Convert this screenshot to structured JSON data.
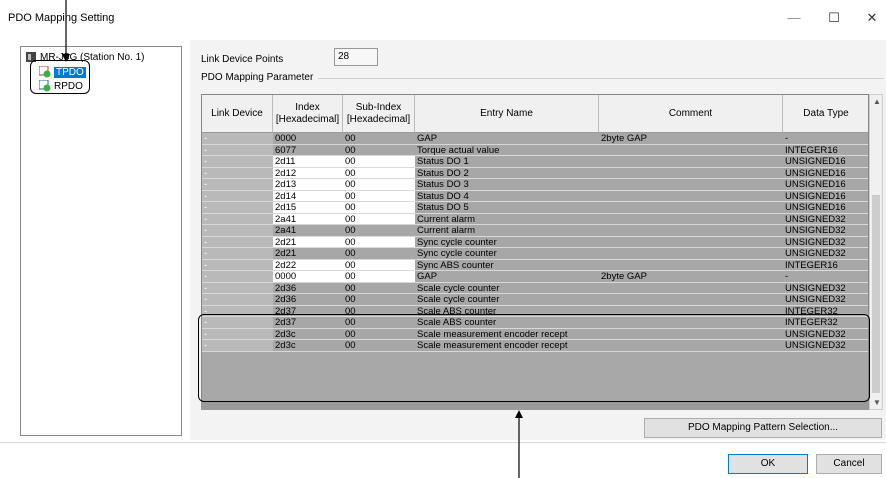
{
  "window": {
    "title": "PDO Mapping Setting",
    "min": "—",
    "max": "☐",
    "close": "✕"
  },
  "tree": {
    "root": "MR-J5G (Station No. 1)",
    "items": [
      {
        "label": "TPDO",
        "selected": true
      },
      {
        "label": "RPDO",
        "selected": false
      }
    ]
  },
  "link_device_points": {
    "label": "Link Device Points",
    "value": "28"
  },
  "mapping_group_label": "PDO Mapping Parameter",
  "columns": [
    "Link Device",
    "Index\n[Hexadecimal]",
    "Sub-Index\n[Hexadecimal]",
    "Entry Name",
    "Comment",
    "Data Type"
  ],
  "rows": [
    {
      "ld": "-",
      "index": "0000",
      "sub": "00",
      "name": "GAP",
      "comment": "2byte GAP",
      "type": "-",
      "style": "g"
    },
    {
      "ld": "-",
      "index": "6077",
      "sub": "00",
      "name": "Torque actual value",
      "comment": "",
      "type": "INTEGER16",
      "style": "g"
    },
    {
      "ld": "-",
      "index": "2d11",
      "sub": "00",
      "name": "Status DO 1",
      "comment": "",
      "type": "UNSIGNED16",
      "style": "w"
    },
    {
      "ld": "-",
      "index": "2d12",
      "sub": "00",
      "name": "Status DO 2",
      "comment": "",
      "type": "UNSIGNED16",
      "style": "w"
    },
    {
      "ld": "-",
      "index": "2d13",
      "sub": "00",
      "name": "Status DO 3",
      "comment": "",
      "type": "UNSIGNED16",
      "style": "w"
    },
    {
      "ld": "-",
      "index": "2d14",
      "sub": "00",
      "name": "Status DO 4",
      "comment": "",
      "type": "UNSIGNED16",
      "style": "w"
    },
    {
      "ld": "-",
      "index": "2d15",
      "sub": "00",
      "name": "Status DO 5",
      "comment": "",
      "type": "UNSIGNED16",
      "style": "w"
    },
    {
      "ld": "-",
      "index": "2a41",
      "sub": "00",
      "name": "Current alarm",
      "comment": "",
      "type": "UNSIGNED32",
      "style": "w"
    },
    {
      "ld": "-",
      "index": "2a41",
      "sub": "00",
      "name": "Current alarm",
      "comment": "",
      "type": "UNSIGNED32",
      "style": "g"
    },
    {
      "ld": "-",
      "index": "2d21",
      "sub": "00",
      "name": "Sync cycle counter",
      "comment": "",
      "type": "UNSIGNED32",
      "style": "w"
    },
    {
      "ld": "-",
      "index": "2d21",
      "sub": "00",
      "name": "Sync cycle counter",
      "comment": "",
      "type": "UNSIGNED32",
      "style": "g"
    },
    {
      "ld": "-",
      "index": "2d22",
      "sub": "00",
      "name": "Sync ABS counter",
      "comment": "",
      "type": "INTEGER16",
      "style": "w"
    },
    {
      "ld": "-",
      "index": "0000",
      "sub": "00",
      "name": "GAP",
      "comment": "2byte GAP",
      "type": "-",
      "style": "w"
    },
    {
      "ld": "-",
      "index": "2d36",
      "sub": "00",
      "name": "Scale cycle counter",
      "comment": "",
      "type": "UNSIGNED32",
      "style": "g"
    },
    {
      "ld": "-",
      "index": "2d36",
      "sub": "00",
      "name": "Scale cycle counter",
      "comment": "",
      "type": "UNSIGNED32",
      "style": "g"
    },
    {
      "ld": "-",
      "index": "2d37",
      "sub": "00",
      "name": "Scale ABS counter",
      "comment": "",
      "type": "INTEGER32",
      "style": "g"
    },
    {
      "ld": "-",
      "index": "2d37",
      "sub": "00",
      "name": "Scale ABS counter",
      "comment": "",
      "type": "INTEGER32",
      "style": "g"
    },
    {
      "ld": "-",
      "index": "2d3c",
      "sub": "00",
      "name": "Scale measurement encoder recept",
      "comment": "",
      "type": "UNSIGNED32",
      "style": "g"
    },
    {
      "ld": "-",
      "index": "2d3c",
      "sub": "00",
      "name": "Scale measurement encoder recept",
      "comment": "",
      "type": "UNSIGNED32",
      "style": "g"
    }
  ],
  "buttons": {
    "pattern": "PDO Mapping Pattern Selection...",
    "ok": "OK",
    "cancel": "Cancel"
  },
  "icons": {
    "root": "module-icon",
    "tpdo": "tpdo-icon",
    "rpdo": "rpdo-icon"
  }
}
